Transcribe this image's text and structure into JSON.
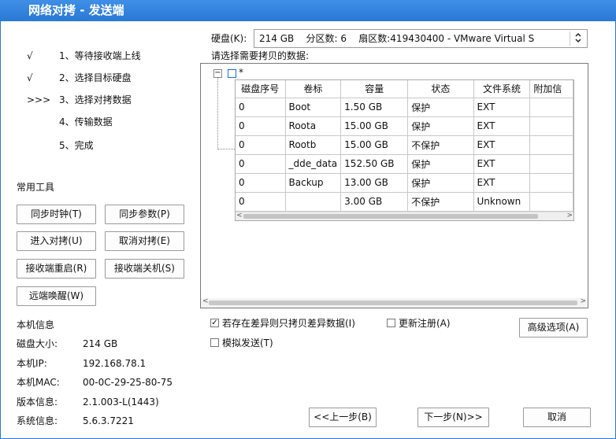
{
  "window": {
    "title": "网络对拷 - 发送端"
  },
  "steps": [
    {
      "mark": "√",
      "label": "1、等待接收端上线"
    },
    {
      "mark": "√",
      "label": "2、选择目标硬盘"
    },
    {
      "mark": ">>>",
      "label": "3、选择对拷数据"
    },
    {
      "mark": "",
      "label": "4、传输数据"
    },
    {
      "mark": "",
      "label": "5、完成"
    }
  ],
  "tools": {
    "heading": "常用工具",
    "buttons": [
      "同步时钟(T)",
      "同步参数(P)",
      "进入对拷(U)",
      "取消对拷(E)",
      "接收端重启(R)",
      "接收端关机(S)",
      "远端唤醒(W)"
    ]
  },
  "local_info": {
    "heading": "本机信息",
    "rows": [
      {
        "key": "磁盘大小:",
        "value": "214 GB"
      },
      {
        "key": "本机IP:",
        "value": "192.168.78.1"
      },
      {
        "key": "本机MAC:",
        "value": "00-0C-29-25-80-75"
      },
      {
        "key": "版本信息:",
        "value": "2.1.003-L(1443)"
      },
      {
        "key": "系统信息:",
        "value": "5.6.3.7221"
      }
    ]
  },
  "disk": {
    "label": "硬盘(K):",
    "selected": "214 GB    分区数: 6    扇区数:419430400 - VMware Virtual S"
  },
  "select_prompt": "请选择需要拷贝的数据:",
  "tree": {
    "root_label": "*",
    "expander": "−"
  },
  "partition_table": {
    "columns": [
      "磁盘序号",
      "卷标",
      "容量",
      "状态",
      "文件系统",
      "附加信"
    ],
    "rows": [
      [
        "0",
        "Boot",
        "1.50 GB",
        "保护",
        "EXT",
        ""
      ],
      [
        "0",
        "Roota",
        "15.00 GB",
        "保护",
        "EXT",
        ""
      ],
      [
        "0",
        "Rootb",
        "15.00 GB",
        "不保护",
        "EXT",
        ""
      ],
      [
        "0",
        "_dde_data",
        "152.50 GB",
        "保护",
        "EXT",
        ""
      ],
      [
        "0",
        "Backup",
        "13.00 GB",
        "保护",
        "EXT",
        ""
      ],
      [
        "0",
        "",
        "3.00 GB",
        "不保护",
        "Unknown",
        ""
      ]
    ]
  },
  "options": {
    "diff_copy": {
      "label": "若存在差异则只拷贝差异数据(I)",
      "checked": true
    },
    "update_reg": {
      "label": "更新注册(A)",
      "checked": false
    },
    "simulate": {
      "label": "模拟发送(T)",
      "checked": false
    },
    "advanced": "高级选项(A)"
  },
  "nav": {
    "prev": "<<上一步(B)",
    "next": "下一步(N)>>",
    "cancel": "取消"
  },
  "icons": {
    "check": "✓",
    "dropdown": "updown-arrow-icon"
  },
  "colors": {
    "titlebar": "#2a78d6"
  }
}
